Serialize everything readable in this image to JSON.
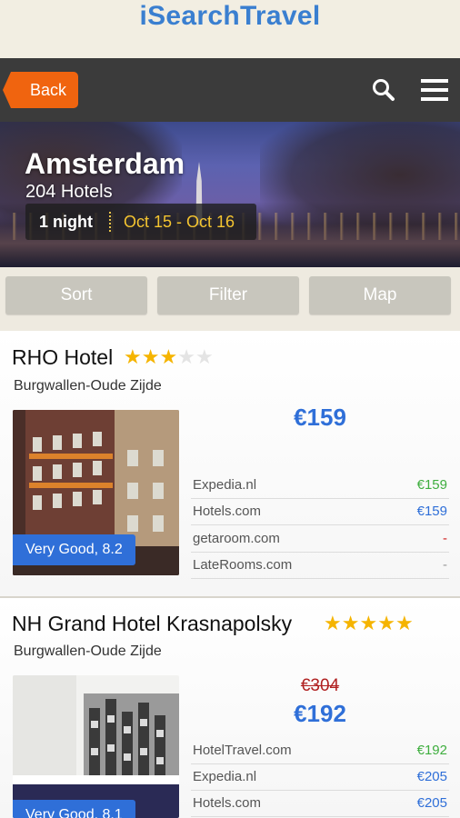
{
  "app": {
    "title": "iSearchTravel"
  },
  "toolbar": {
    "back_label": "Back",
    "icons": [
      "search-icon",
      "menu-icon"
    ]
  },
  "hero": {
    "city": "Amsterdam",
    "hotel_count": "204 Hotels",
    "nights": "1 night",
    "dates": "Oct 15 - Oct 16"
  },
  "actions": {
    "sort": "Sort",
    "filter": "Filter",
    "map": "Map"
  },
  "colors": {
    "accent": "#3a7fd0",
    "back_button": "#f0640f",
    "rating_badge": "#2f6fd8",
    "star": "#f5b400",
    "old_price": "#b02020"
  },
  "hotels": [
    {
      "name": "RHO Hotel",
      "stars": 3,
      "max_stars": 5,
      "district": "Burgwallen-Oude Zijde",
      "rating": "Very Good, 8.2",
      "price": "€159",
      "providers": [
        {
          "name": "Expedia.nl",
          "price": "€159",
          "color": "green"
        },
        {
          "name": "Hotels.com",
          "price": "€159",
          "color": "blue"
        },
        {
          "name": "getaroom.com",
          "price": "-",
          "color": "red"
        },
        {
          "name": "LateRooms.com",
          "price": "-",
          "color": "grey"
        }
      ]
    },
    {
      "name": "NH Grand Hotel Krasnapolsky",
      "stars": 5,
      "max_stars": 5,
      "district": "Burgwallen-Oude Zijde",
      "rating": "Very Good, 8.1",
      "old_price": "€304",
      "price": "€192",
      "providers": [
        {
          "name": "HotelTravel.com",
          "price": "€192",
          "color": "green"
        },
        {
          "name": "Expedia.nl",
          "price": "€205",
          "color": "blue"
        },
        {
          "name": "Hotels.com",
          "price": "€205",
          "color": "blue"
        }
      ]
    }
  ]
}
